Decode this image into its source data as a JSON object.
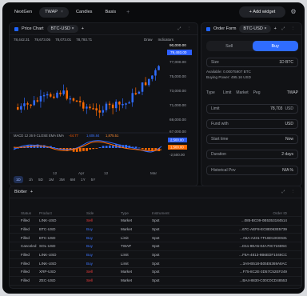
{
  "topbar": {
    "tabs": [
      "NextGen",
      "TWAP",
      "Candles",
      "Basis"
    ],
    "add_widget": "+ Add widget"
  },
  "chart_panel": {
    "title": "Price Chart",
    "symbol": "BTC-USD",
    "ohlc": [
      "78,442.31",
      "78,673.05",
      "78,073.01",
      "78,793.71"
    ],
    "draw": "Draw",
    "indicators": "Indicators",
    "price_labels": [
      "90,000.00",
      "79,493.00",
      "77,000.00",
      "75,000.00",
      "73,000.00",
      "71,000.00",
      "69,000.00",
      "67,000.00",
      "65,000.00"
    ],
    "macd_label": "MACD 12 26 9 CLOSE EMA EMA",
    "macd_values": [
      "-44.77",
      "1,606.84",
      "1,875.51"
    ],
    "macd_axis": [
      "2,500.00",
      "1,500.00",
      "-2,500.00"
    ],
    "dates": [
      "12",
      "Apr",
      "12",
      "Mar"
    ],
    "timeframes": [
      "1D",
      "1h",
      "5D",
      "1M",
      "3M",
      "6M",
      "1Y",
      "5Y"
    ]
  },
  "order_form": {
    "title": "Order Form",
    "symbol": "BTC-USD",
    "sell": "Sell",
    "buy": "Buy",
    "size_label": "Size",
    "size_unit": "1D BTC",
    "available": "Available: 0.00075907 BTC",
    "buying_power": "Buying Power: 495.16 USD",
    "type_label": "Type",
    "types": [
      "Limit",
      "Market",
      "Peg",
      "TWAP"
    ],
    "limit_label": "Limit",
    "limit_value": "78,703",
    "limit_unit": "USD",
    "fund_label": "Fund with",
    "fund_value": "USD",
    "start_label": "Start time",
    "start_value": "Now",
    "duration_label": "Duration",
    "duration_value": "2 days",
    "historical_label": "Historical Pov",
    "historical_value": "N/A %"
  },
  "blotter": {
    "title": "Blotter",
    "headers": [
      "Status",
      "Product",
      "Side",
      "Type",
      "Instrument",
      "Order ID"
    ],
    "rows": [
      [
        "Filled",
        "LINK-USD",
        "Sell",
        "Market",
        "Spot",
        "...085-BC09-0B5353184514"
      ],
      [
        "Filled",
        "BTC-USD",
        "Buy",
        "Market",
        "Spot",
        "...67C-AEF8-EC8E063E5739"
      ],
      [
        "Filled",
        "BTC-USD",
        "Buy",
        "Limit",
        "Spot",
        "...A6A-A231-7F16D13CE631"
      ],
      [
        "Canceled",
        "SOL-USD",
        "Buy",
        "TWAP",
        "Spot",
        "...D11-9EA5-04A70C724D5C"
      ],
      [
        "Filled",
        "LINK-USD",
        "Buy",
        "Limit",
        "Spot",
        "...F8A-4813-9B6EDF1046CC"
      ],
      [
        "Filled",
        "LINK-USD",
        "Buy",
        "Limit",
        "Spot",
        "...3A9-B518-B05E6369A8AC"
      ],
      [
        "Filled",
        "XRP-USD",
        "Sell",
        "Market",
        "Spot",
        "...F75-8C2E-3D57C52EF249"
      ],
      [
        "Filled",
        "ZEC-USD",
        "Sell",
        "Market",
        "Spot",
        "...BA4-8830-C00C0CD48553"
      ]
    ]
  },
  "colors": {
    "buy": "#3e76ff",
    "sell": "#ff3f3f",
    "accent": "#2f6cff"
  }
}
